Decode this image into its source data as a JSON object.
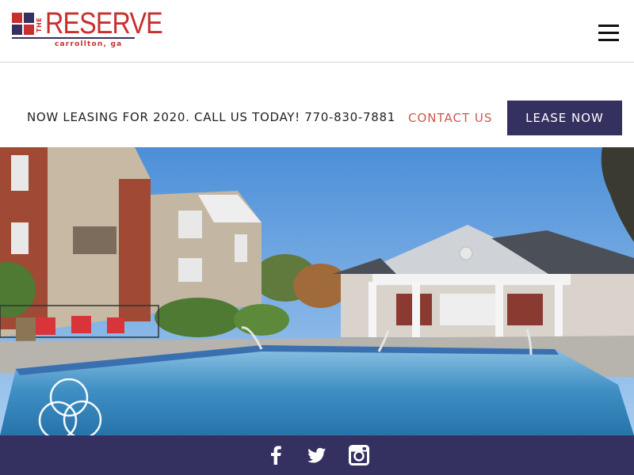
{
  "header": {
    "logo": {
      "word": "RESERVE",
      "prefix": "THE",
      "city": "carrollton, ga"
    },
    "menu_icon": "hamburger-menu-icon"
  },
  "lease_bar": {
    "announcement": "NOW LEASING FOR 2020. CALL US TODAY! 770-830-7881",
    "contact_label": "CONTACT US",
    "lease_label": "LEASE NOW"
  },
  "social": {
    "icons": [
      "facebook-icon",
      "twitter-icon",
      "instagram-icon"
    ]
  },
  "colors": {
    "brand_navy": "#34305f",
    "brand_red": "#c8302f",
    "contact_red": "#d0564f"
  }
}
